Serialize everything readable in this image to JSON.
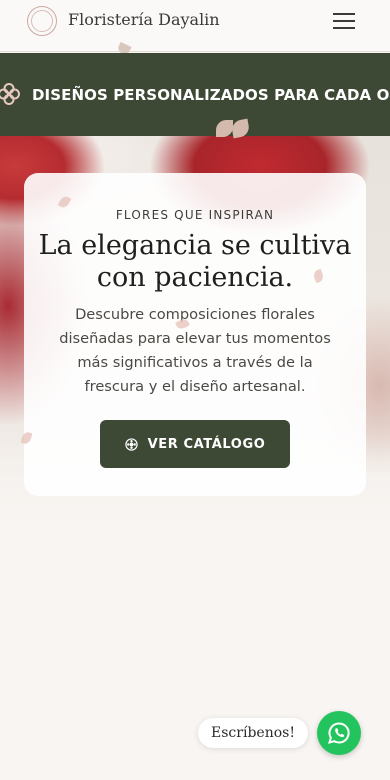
{
  "header": {
    "brand": "Floristería Dayalin",
    "logo_icon": "floral-wreath-logo",
    "menu_icon": "hamburger-menu-icon"
  },
  "banner": {
    "text": "DISEÑOS PERSONALIZADOS PARA CADA OCASIÓN",
    "icon": "flower-outline-icon"
  },
  "hero": {
    "eyebrow": "FLORES QUE INSPIRAN",
    "title": "La elegancia se cultiva con paciencia.",
    "description": "Descubre composiciones florales diseñadas para elevar tus momentos más significativos a través de la frescura y el diseño artesanal.",
    "button_label": "VER CATÁLOGO",
    "button_icon": "flower-icon"
  },
  "chat": {
    "bubble_text": "Escríbenos!",
    "button_icon": "whatsapp-icon"
  },
  "colors": {
    "accent": "#3e4935",
    "background": "#f8f5f2",
    "whatsapp": "#23c35d"
  }
}
